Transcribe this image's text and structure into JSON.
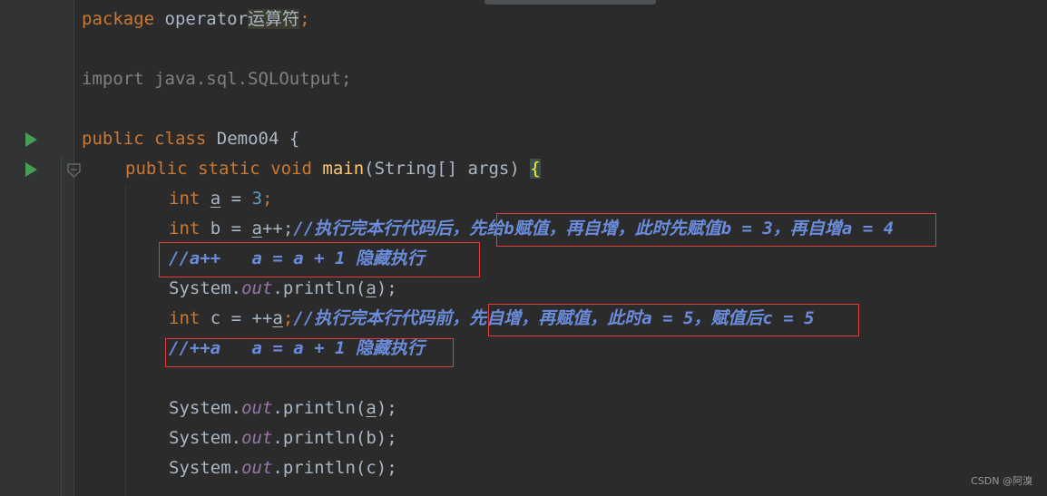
{
  "editor": {
    "scrollbar_visible": true
  },
  "code": {
    "line1": {
      "kw": "package",
      "name": "operator",
      "name_cjk": "运算符",
      "semi": ";"
    },
    "line2": {
      "text": "import java.sql.SQLOutput;"
    },
    "line3": {
      "kw1": "public",
      "kw2": "class",
      "name": "Demo04",
      "brace": "{"
    },
    "line4": {
      "kw1": "public",
      "kw2": "static",
      "kw3": "void",
      "fn": "main",
      "paren": "(String[] args)",
      "brace": "{"
    },
    "line5": {
      "kw": "int",
      "var": "a",
      "eq": " = ",
      "num": "3",
      "semi": ";"
    },
    "line6": {
      "kw": "int",
      "mid": " b = ",
      "var": "a",
      "op": "++;",
      "comment": "//执行完本行代码后，先给b赋值，再自增，此时先赋值b = 3，再自增a = 4"
    },
    "line7": {
      "comment": "//a++   a = a + 1 隐藏执行"
    },
    "line8": {
      "cls": "System.",
      "field": "out",
      "call": ".println(",
      "var": "a",
      "end": ");"
    },
    "line9": {
      "kw": "int",
      "mid": " c = ++",
      "var": "a",
      "semi": ";",
      "comment": "//执行完本行代码前，先自增，再赋值，此时a = 5，赋值后c = 5"
    },
    "line10": {
      "comment": "//++a   a = a + 1 隐藏执行"
    },
    "line11": {
      "cls": "System.",
      "field": "out",
      "call": ".println(",
      "var": "a",
      "end": ");"
    },
    "line12": {
      "cls": "System.",
      "field": "out",
      "call": ".println(b);"
    },
    "line13": {
      "cls": "System.",
      "field": "out",
      "call": ".println(c);"
    }
  },
  "watermark": "CSDN @阿溴",
  "colors": {
    "keyword": "#cc7832",
    "comment": "#6a8cdb",
    "annotation_box": "#e23b3b",
    "run_icon": "#499c54"
  },
  "icons": [
    "run-gutter-icon",
    "fold-marker-icon"
  ]
}
